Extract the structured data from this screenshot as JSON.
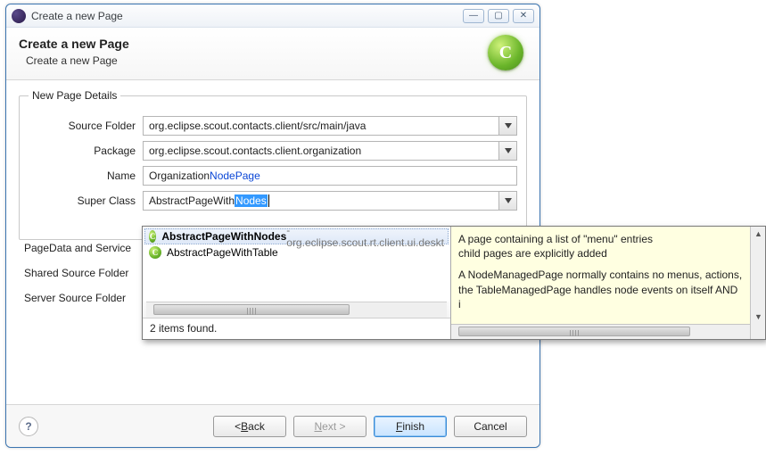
{
  "window": {
    "title": "Create a new Page"
  },
  "header": {
    "title": "Create a new Page",
    "subtitle": "Create a new Page"
  },
  "group": {
    "legend": "New Page Details",
    "fields": {
      "sourceFolder": {
        "label": "Source Folder",
        "value": "org.eclipse.scout.contacts.client/src/main/java"
      },
      "package": {
        "label": "Package",
        "value": "org.eclipse.scout.contacts.client.organization"
      },
      "name": {
        "label": "Name",
        "valuePrefix": "Organization",
        "valueHighlight": "NodePage"
      },
      "superClass": {
        "label": "Super Class",
        "valuePrefix": "AbstractPageWith",
        "valueSelection": "Nodes"
      }
    },
    "extras": {
      "pageData": "PageData and Service",
      "sharedSource": "Shared Source Folder",
      "serverSource": "Server Source Folder"
    }
  },
  "popup": {
    "items": [
      {
        "name": "AbstractPageWithNodes",
        "pkg": " - org.eclipse.scout.rt.client.ui.deskt",
        "selected": true
      },
      {
        "name": "AbstractPageWithTable",
        "pkg": "",
        "selected": false
      }
    ],
    "status": "2 items found.",
    "doc": {
      "line1": "A page containing a list of \"menu\" entries",
      "line2": "child pages are explicitly added",
      "line3": "A NodeManagedPage normally contains no menus, actions,",
      "line4": "the TableManagedPage handles node events on itself AND i"
    }
  },
  "footer": {
    "back": "< Back",
    "next": "Next >",
    "finish": "Finish",
    "cancel": "Cancel"
  }
}
